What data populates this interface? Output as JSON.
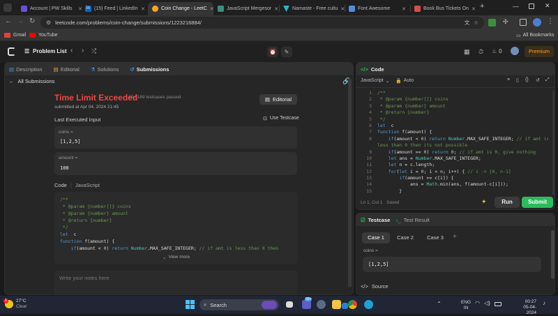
{
  "browser": {
    "tabs": [
      {
        "title": "Account | PW Skills",
        "color": "#6b4fd8"
      },
      {
        "title": "(15) Feed | LinkedIn",
        "color": "#0a66c2"
      },
      {
        "title": "Coin Change - LeetC",
        "color": "#f5a623"
      },
      {
        "title": "JavaScript Mergesor",
        "color": "#3a8f7a"
      },
      {
        "title": "Namaste - Free cultu",
        "color": "#2ab3c8"
      },
      {
        "title": "Font Awesome",
        "color": "#528dd7"
      },
      {
        "title": "Book Bus Tickets On",
        "color": "#d84e4e"
      }
    ],
    "url": "leetcode.com/problems/coin-change/submissions/1223216884/",
    "bookmarks": [
      "Gmail",
      "YouTube"
    ],
    "all_bookmarks": "All Bookmarks"
  },
  "header": {
    "problem_list": "Problem List",
    "fire_count": "0",
    "premium": "Premium"
  },
  "left": {
    "tabs": [
      "Description",
      "Editorial",
      "Solutions",
      "Submissions"
    ],
    "back": "All Submissions",
    "result": {
      "status": "Time Limit Exceeded",
      "passed": "15 / 189 testcases passed",
      "submitted": "submitted at Apr 04, 2024 21:45",
      "editorial": "Editorial"
    },
    "last_input_label": "Last Executed Input",
    "use_testcase": "Use Testcase",
    "coins_label": "coins =",
    "coins_value": "[1,2,5]",
    "amount_label": "amount =",
    "amount_value": "100",
    "code_label": "Code",
    "code_lang": "JavaScript",
    "view_more": "View more",
    "notes_placeholder": "Write your notes here"
  },
  "editor": {
    "title": "Code",
    "language": "JavaScript",
    "mode": "Auto",
    "status_pos": "Ln 1, Col 1",
    "status_saved": "Saved",
    "run": "Run",
    "submit": "Submit"
  },
  "code_lines": [
    {
      "n": "1",
      "html": "<span class='token-c'>/**</span>"
    },
    {
      "n": "2",
      "html": "<span class='token-c'> * @param {number[]} coins</span>"
    },
    {
      "n": "3",
      "html": "<span class='token-c'> * @param {number} amount</span>"
    },
    {
      "n": "4",
      "html": "<span class='token-c'> * @return {number}</span>"
    },
    {
      "n": "5",
      "html": "<span class='token-c'> */</span>"
    },
    {
      "n": "6",
      "html": "<span class='token-k'>let</span>  c"
    },
    {
      "n": "7",
      "html": "<span class='token-k'>function</span> f(amount) {"
    },
    {
      "n": "8",
      "html": "    <span class='token-k'>if</span>(amount &lt; <span class='token-n'>0</span>) <span class='token-k'>return</span> <span class='token-t'>Number</span>.MAX_SAFE_INTEGER; <span class='token-c'>// if amt is</span>"
    },
    {
      "n": "",
      "html": "<span class='token-c'>less than 0 then its not possible</span>"
    },
    {
      "n": "9",
      "html": "    <span class='token-k'>if</span>(amount == <span class='token-n'>0</span>) <span class='token-k'>return</span> <span class='token-n'>0</span>; <span class='token-c'>// if amt is 0, give nothing</span>"
    },
    {
      "n": "10",
      "html": "    <span class='token-k'>let</span> ans = <span class='token-t'>Number</span>.MAX_SAFE_INTEGER;"
    },
    {
      "n": "11",
      "html": "    <span class='token-k'>let</span> n = c.length;"
    },
    {
      "n": "12",
      "html": "    <span class='token-k'>for</span>(<span class='token-k'>let</span> i = <span class='token-n'>0</span>; i &lt; n; i++) { <span class='token-c'>// i -&gt; [0, n-1]</span>"
    },
    {
      "n": "13",
      "html": "        <span class='token-k'>if</span>(amount &gt;= c[i]) {"
    },
    {
      "n": "14",
      "html": "            ans = <span class='token-t'>Math</span>.min(ans, f(amount-c[i]));"
    },
    {
      "n": "15",
      "html": "        }"
    }
  ],
  "preview_lines": [
    "<span class='token-c'>/**</span>",
    "<span class='token-c'> * @param {number[]} coins</span>",
    "<span class='token-c'> * @param {number} amount</span>",
    "<span class='token-c'> * @return {number}</span>",
    "<span class='token-c'> */</span>",
    "<span class='token-k'>let</span>  c",
    "<span class='token-k'>function</span> f(amount) {",
    "    <span class='token-k'>if</span>(amount &lt; <span class='token-n'>0</span>) <span class='token-k'>return</span> <span class='token-t'>Number</span>.MAX_SAFE_INTEGER; <span class='token-c'>// if amt is less than 0 then</span>"
  ],
  "testpanel": {
    "tab_testcase": "Testcase",
    "tab_result": "Test Result",
    "cases": [
      "Case 1",
      "Case 2",
      "Case 3"
    ],
    "plus": "+",
    "coins_label": "coins =",
    "coins_value": "[1,2,5]",
    "source": "Source"
  },
  "taskbar": {
    "temp": "27°C",
    "weather": "Clear",
    "search": "Search",
    "lang1": "ENG",
    "lang2": "IN",
    "time": "00:27",
    "date": "05-04-2024",
    "badge": "99+"
  }
}
